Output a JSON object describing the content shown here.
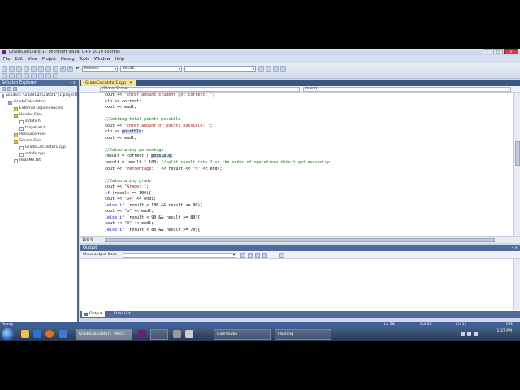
{
  "window": {
    "title": "GradeCalculator1 - Microsoft Visual C++ 2010 Express"
  },
  "menu": [
    "File",
    "Edit",
    "View",
    "Project",
    "Debug",
    "Tools",
    "Window",
    "Help"
  ],
  "toolbar": {
    "config": "Release",
    "platform": "Win32",
    "search": ""
  },
  "solution_explorer": {
    "title": "Solution Explorer",
    "tree": [
      {
        "label": "Solution 'GradeCalculator1' (1 project)",
        "level": 0,
        "kind": "sol"
      },
      {
        "label": "GradeCalculator1",
        "level": 1,
        "kind": "proj"
      },
      {
        "label": "External Dependencies",
        "level": 2,
        "kind": "folder"
      },
      {
        "label": "Header Files",
        "level": 2,
        "kind": "folder"
      },
      {
        "label": "stdafx.h",
        "level": 3,
        "kind": "file"
      },
      {
        "label": "targetver.h",
        "level": 3,
        "kind": "file"
      },
      {
        "label": "Resource Files",
        "level": 2,
        "kind": "folder"
      },
      {
        "label": "Source Files",
        "level": 2,
        "kind": "folder"
      },
      {
        "label": "GradeCalculator1.cpp",
        "level": 3,
        "kind": "file"
      },
      {
        "label": "stdafx.cpp",
        "level": 3,
        "kind": "file"
      },
      {
        "label": "ReadMe.txt",
        "level": 2,
        "kind": "file"
      }
    ]
  },
  "editor": {
    "tab": "GradeCalculator1.cpp",
    "scope_left": "(Global Scope)",
    "scope_right": "main()",
    "zoom": "100 %",
    "lines": [
      "cout << \"Enter amount student got correct: \";",
      "cin >> correct;",
      "cout << endl;",
      "",
      "//Getting total points possible",
      "cout << \"Enter amount of points possible: \";",
      "cin >> possible;",
      "cout << endl;",
      "",
      "//Calculating percentage",
      "result = correct / possible;",
      "result = result * 100; //split result into 2 so the order of operations didn't get messed up",
      "cout << \"Percentage: \" << result << \"%\" << endl;",
      "",
      "//Calculating grade",
      "cout << \"Grade: \";",
      "if (result == 100){",
      "cout << \"A+\" << endl;",
      "}else if (result < 100 && result >= 90){",
      "cout << \"A\" << endl;",
      "}else if (result < 90 && result >= 80){",
      "cout << \"B\" << endl;",
      "}else if (result < 80 && result >= 70){"
    ]
  },
  "output": {
    "title": "Output",
    "show_from_label": "Show output from:",
    "source": ""
  },
  "bottom_tabs": [
    "Output",
    "Error List"
  ],
  "status": {
    "ready": "Ready",
    "line": "Ln 28",
    "col": "Col 28",
    "ch": "Ch 17",
    "mode": "INS"
  },
  "taskbar": {
    "buttons": [
      "GradeCalculator1 - Micr...",
      "",
      "CamStudio",
      "Flashing"
    ],
    "clock_time": "1:37 PM",
    "clock_date": ""
  }
}
